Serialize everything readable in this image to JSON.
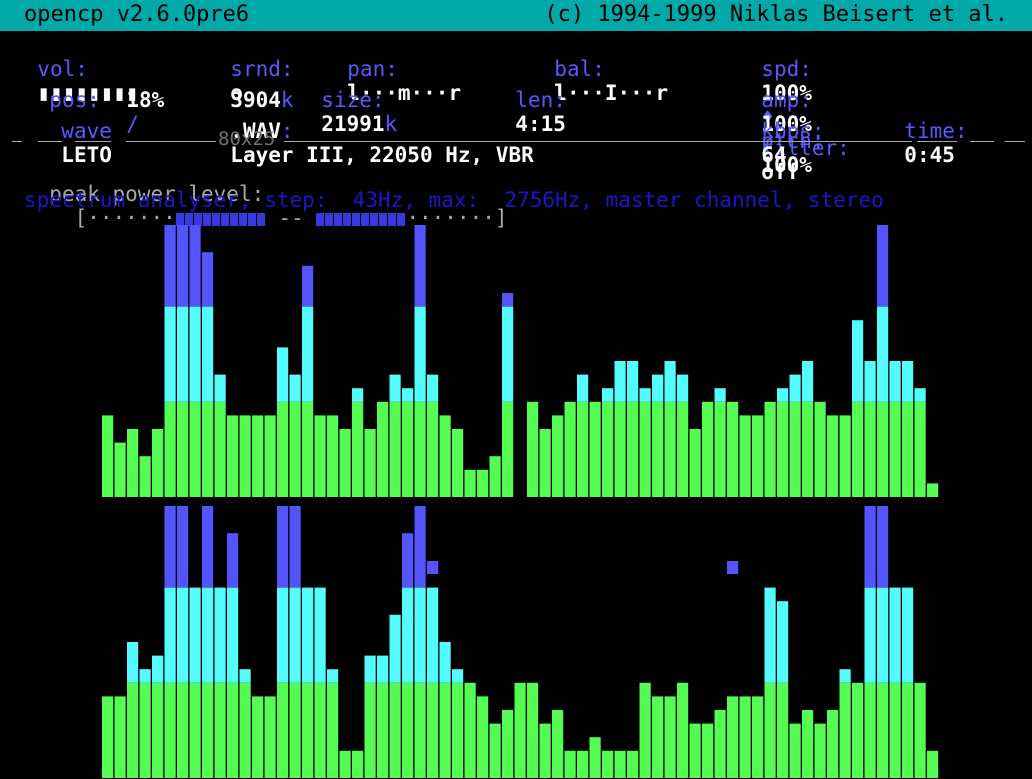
{
  "app": {
    "title": "opencp v2.6.0pre6",
    "copyright": "(c) 1994-1999 Niklas Beisert et al."
  },
  "status": {
    "vol_label": "vol:",
    "vol_bar": "▮▮▮▮▮▮▮▮",
    "srnd_label": "srnd:",
    "srnd_value": "o",
    "pan_label": "pan:",
    "pan_value": "l···m···r",
    "bal_label": "bal:",
    "bal_value": "l···I···r",
    "spd_label": "spd:",
    "spd_value": "100%",
    "ptch_sep": "♦",
    "ptch_label": "ptch:",
    "ptch_value": "100%",
    "pos_label": "pos:",
    "pos_value": "18%",
    "pos_sep": "/",
    "pos_k": "3904",
    "pos_k_unit": "k",
    "size_label": "size:",
    "size_value": "21991",
    "size_unit": "k",
    "len_label": "len:",
    "len_value": "4:15",
    "amp_label": "amp:",
    "amp_value": "100%",
    "filter_label": "filter:",
    "filter_value": "off",
    "wave_label": "wave",
    "wave_name": "LETO",
    "wave_ext": ".WAV",
    "wave_info": "Layer III, 22050 Hz, VBR",
    "kbps_label": "kbps:",
    "kbps_value": "64",
    "time_label": "time:",
    "time_value": "0:45"
  },
  "screen_size": "80x25",
  "peak": {
    "label": "peak power level:",
    "open": "[",
    "close": "]",
    "mid": "--",
    "left_dots": "·······",
    "right_dots": "·······",
    "left_blocks": 10,
    "right_blocks": 10
  },
  "spectrum_caption": "spectrum analyser, step:  43Hz, max:  2756Hz, master channel, stereo",
  "colors": {
    "green": "#54fc54",
    "cyan": "#54fcfc",
    "blue": "#5454fc"
  },
  "chart_data": {
    "type": "bar",
    "title": "spectrum analyser",
    "channels": [
      {
        "name": "top",
        "values": [
          6,
          4,
          5,
          3,
          5,
          20,
          20,
          20,
          18,
          9,
          6,
          6,
          6,
          6,
          11,
          9,
          17,
          6,
          6,
          5,
          8,
          5,
          7,
          9,
          8,
          20,
          9,
          6,
          5,
          2,
          2,
          3,
          15,
          0,
          7,
          5,
          6,
          7,
          9,
          7,
          8,
          10,
          10,
          8,
          9,
          10,
          9,
          5,
          7,
          8,
          7,
          6,
          6,
          7,
          8,
          9,
          10,
          7,
          6,
          6,
          13,
          10,
          20,
          10,
          10,
          8,
          1
        ],
        "peaks": [
          0,
          0,
          0,
          0,
          0,
          0,
          0,
          0,
          0,
          0,
          0,
          0,
          0,
          0,
          0,
          0,
          0,
          0,
          0,
          0,
          0,
          0,
          0,
          0,
          0,
          0,
          0,
          0,
          0,
          0,
          0,
          0,
          0,
          0,
          0,
          0,
          0,
          0,
          0,
          0,
          0,
          0,
          0,
          0,
          0,
          0,
          0,
          0,
          0,
          0,
          0,
          0,
          0,
          0,
          0,
          0,
          0,
          0,
          0,
          0,
          0,
          0,
          0,
          0,
          0,
          0,
          0
        ]
      },
      {
        "name": "bottom",
        "values": [
          6,
          6,
          10,
          8,
          9,
          20,
          20,
          14,
          20,
          14,
          18,
          8,
          6,
          6,
          20,
          20,
          14,
          14,
          8,
          2,
          2,
          9,
          9,
          12,
          18,
          20,
          14,
          10,
          8,
          7,
          6,
          4,
          5,
          7,
          7,
          4,
          5,
          2,
          2,
          3,
          2,
          2,
          2,
          7,
          6,
          6,
          7,
          4,
          4,
          5,
          6,
          6,
          6,
          14,
          13,
          4,
          5,
          4,
          5,
          8,
          7,
          20,
          20,
          14,
          14,
          7,
          2
        ],
        "peaks": [
          0,
          0,
          0,
          0,
          0,
          0,
          0,
          0,
          0,
          0,
          0,
          0,
          0,
          0,
          0,
          0,
          0,
          0,
          0,
          0,
          0,
          0,
          0,
          0,
          0,
          0,
          15,
          0,
          0,
          0,
          0,
          0,
          0,
          0,
          0,
          0,
          0,
          0,
          0,
          0,
          0,
          0,
          0,
          0,
          0,
          0,
          0,
          0,
          0,
          0,
          15,
          0,
          0,
          0,
          0,
          0,
          0,
          0,
          0,
          0,
          0,
          0,
          0,
          0,
          0,
          0,
          0
        ]
      }
    ],
    "ylim": [
      0,
      20
    ]
  }
}
